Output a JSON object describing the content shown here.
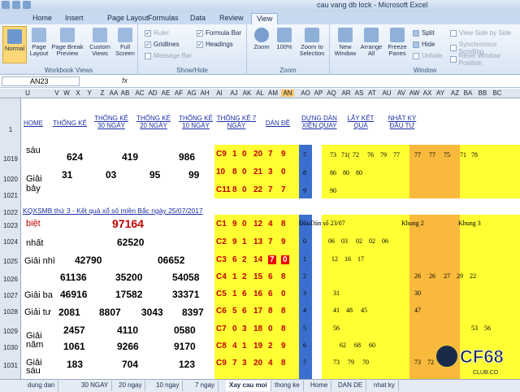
{
  "window": {
    "title": "cau vang db lock - Microsoft Excel"
  },
  "ribbon_tabs": [
    "Home",
    "Insert",
    "Page Layout",
    "Formulas",
    "Data",
    "Review",
    "View"
  ],
  "ribbon": {
    "workbook_views": {
      "label": "Workbook Views",
      "normal": "Normal",
      "page_layout": "Page Layout",
      "page_break": "Page Break Preview",
      "custom": "Custom Views",
      "full": "Full Screen"
    },
    "show_hide": {
      "label": "Show/Hide",
      "ruler": "Ruler",
      "gridlines": "Gridlines",
      "message_bar": "Message Bar",
      "formula_bar": "Formula Bar",
      "headings": "Headings"
    },
    "zoom": {
      "label": "Zoom",
      "zoom": "Zoom",
      "pct": "100%",
      "selection": "Zoom to Selection"
    },
    "window": {
      "label": "Window",
      "new": "New Window",
      "arrange": "Arrange All",
      "freeze": "Freeze Panes",
      "split": "Split",
      "hide": "Hide",
      "unhide": "Unhide",
      "side": "View Side by Side",
      "sync": "Synchronous Scrolling",
      "reset": "Reset Window Position"
    }
  },
  "formula_bar": {
    "name_box": "AN23",
    "fx": "fx"
  },
  "columns": [
    "U",
    "V",
    "W",
    "X",
    "Y",
    "Z",
    "AA",
    "AB",
    "AC",
    "AD",
    "AE",
    "AF",
    "AG",
    "AH",
    "AI",
    "AJ",
    "AK",
    "AL",
    "AM",
    "AN",
    "AO",
    "AP",
    "AQ",
    "AR",
    "AS",
    "AT",
    "AU",
    "AV",
    "AW",
    "AX",
    "AY",
    "AZ",
    "BA",
    "BB",
    "BC"
  ],
  "rows": [
    "1",
    "1019",
    "1020",
    "1021",
    "1022",
    "1023",
    "1024",
    "1025",
    "1026",
    "1027",
    "1028",
    "1029",
    "1030",
    "1031"
  ],
  "header_links": [
    "HOME",
    "THỐNG KÊ",
    "THỐNG KÊ 30 NGÀY",
    "THỐNG KÊ 20 NGÀY",
    "THỐNG KÊ 10 NGÀY",
    "THỐNG KÊ 7 NGÀY",
    "DÀN ĐỀ",
    "DỰNG DÀN XIÊN QUAY",
    "LẤY KẾT QUẢ",
    "NHẬT KÝ ĐẦU TƯ"
  ],
  "prev_block": {
    "labels": [
      "sáu",
      "Giải bảy"
    ],
    "r1019": [
      "624",
      "419",
      "986"
    ],
    "r1020": [
      "31",
      "03",
      "95",
      "99"
    ]
  },
  "kq_title": "KQXSMB thứ 3 - Kết quả xổ số miền Bắc ngày 25/07/2017",
  "prizes": {
    "special_label": "biệt",
    "special": "97164",
    "first_label": "nhất",
    "first": "62520",
    "second_label": "Giải nhì",
    "second": [
      "42790",
      "06652"
    ],
    "third_label": "Giải ba",
    "third": [
      "61136",
      "35200",
      "54058",
      "46916",
      "17582",
      "33371"
    ],
    "fourth_label": "Giải tư",
    "fourth": [
      "2081",
      "8807",
      "3043",
      "8397"
    ],
    "fifth_label": "Giải năm",
    "fifth": [
      "2457",
      "4110",
      "0580",
      "1061",
      "9266",
      "9170"
    ],
    "sixth_label": "Giải sáu",
    "sixth": [
      "183",
      "704",
      "123"
    ]
  },
  "yellow_rows": [
    [
      "C9",
      "1",
      "0",
      "20",
      "7",
      "9"
    ],
    [
      "10",
      "8",
      "0",
      "21",
      "3",
      "0"
    ],
    [
      "C11",
      "8",
      "0",
      "22",
      "7",
      "7"
    ],
    [
      "C1",
      "9",
      "0",
      "12",
      "4",
      "8"
    ],
    [
      "C2",
      "9",
      "1",
      "13",
      "7",
      "9"
    ],
    [
      "C3",
      "6",
      "2",
      "14",
      "7",
      "0"
    ],
    [
      "C4",
      "1",
      "2",
      "15",
      "6",
      "8"
    ],
    [
      "C5",
      "1",
      "6",
      "16",
      "6",
      "0"
    ],
    [
      "C6",
      "5",
      "6",
      "17",
      "8",
      "8"
    ],
    [
      "C7",
      "0",
      "3",
      "18",
      "0",
      "8"
    ],
    [
      "C8",
      "4",
      "1",
      "19",
      "2",
      "9"
    ],
    [
      "C9",
      "7",
      "3",
      "20",
      "4",
      "8"
    ]
  ],
  "an_col": [
    "7",
    "8",
    "9",
    "0",
    "1",
    "2",
    "3",
    "4",
    "5",
    "6",
    "7"
  ],
  "right_data": {
    "r1019": [
      "73",
      "71(",
      "72",
      "76",
      "79",
      "77",
      "77",
      "77",
      "75",
      "71",
      "78"
    ],
    "r1020": [
      "86",
      "80",
      "80"
    ],
    "r1021": [
      "90"
    ],
    "r1023": [
      "Đầu",
      "Dàn số 23/07",
      "Khung 2",
      "Khung 3"
    ],
    "r1024": [
      "06",
      "03",
      "02",
      "02",
      "06"
    ],
    "r1025": [
      "12",
      "16",
      "17"
    ],
    "r1026": [
      "26",
      "26",
      "27",
      "29",
      "22"
    ],
    "r1027": [
      "31",
      "30"
    ],
    "r1028": [
      "41",
      "48",
      "45",
      "47"
    ],
    "r1029": [
      "56",
      "53",
      "56"
    ],
    "r1030": [
      "62",
      "68",
      "60"
    ],
    "r1031": [
      "73",
      "79",
      "70",
      "73",
      "72"
    ]
  },
  "sheet_tabs": [
    "dung dan",
    "30 NGAY",
    "20 ngay",
    "10 ngay",
    "7 ngay",
    "Xay cau moi",
    "thong ke",
    "Home",
    "DAN DE",
    "nhat ky"
  ],
  "active_sheet": "Xay cau moi",
  "watermark": {
    "text": "CF68",
    "sub": "CLUB.CO"
  },
  "colors": {
    "yellow": "#ffff33",
    "orange": "#f8b93c",
    "blue": "#3b6fcf",
    "red": "#c00000",
    "link": "#1c2fa8"
  }
}
